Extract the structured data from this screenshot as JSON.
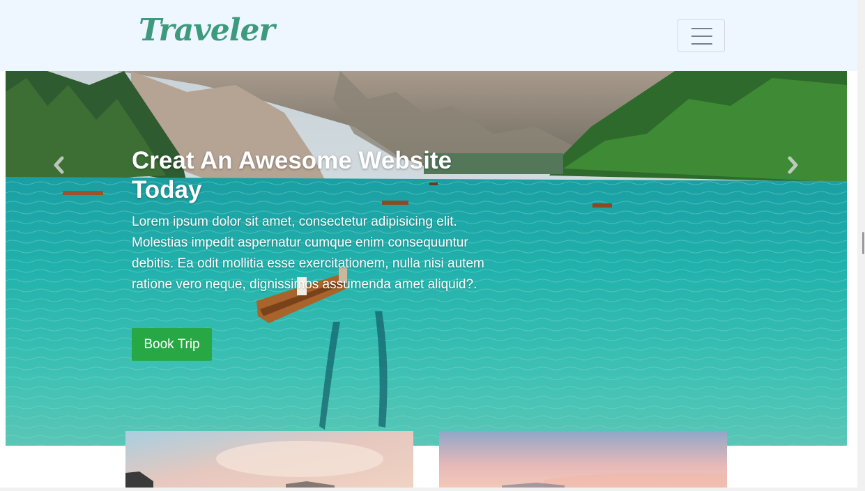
{
  "navbar": {
    "brand": "Traveler",
    "toggler_icon": "hamburger-menu-icon"
  },
  "hero": {
    "title": "Creat An Awesome Website Today",
    "text": "Lorem ipsum dolor sit amet, consectetur adipisicing elit. Molestias impedit aspernatur cumque enim consequuntur debitis. Ea odit mollitia esse exercitationem, nulla nisi autem ratione vero neque, dignissimos assumenda amet aliquid?.",
    "button_label": "Book Trip",
    "prev_icon": "chevron-left-icon",
    "next_icon": "chevron-right-icon"
  },
  "colors": {
    "brand": "#3e9a7c",
    "navbar_bg": "#eef6ff",
    "button": "#28a745"
  }
}
